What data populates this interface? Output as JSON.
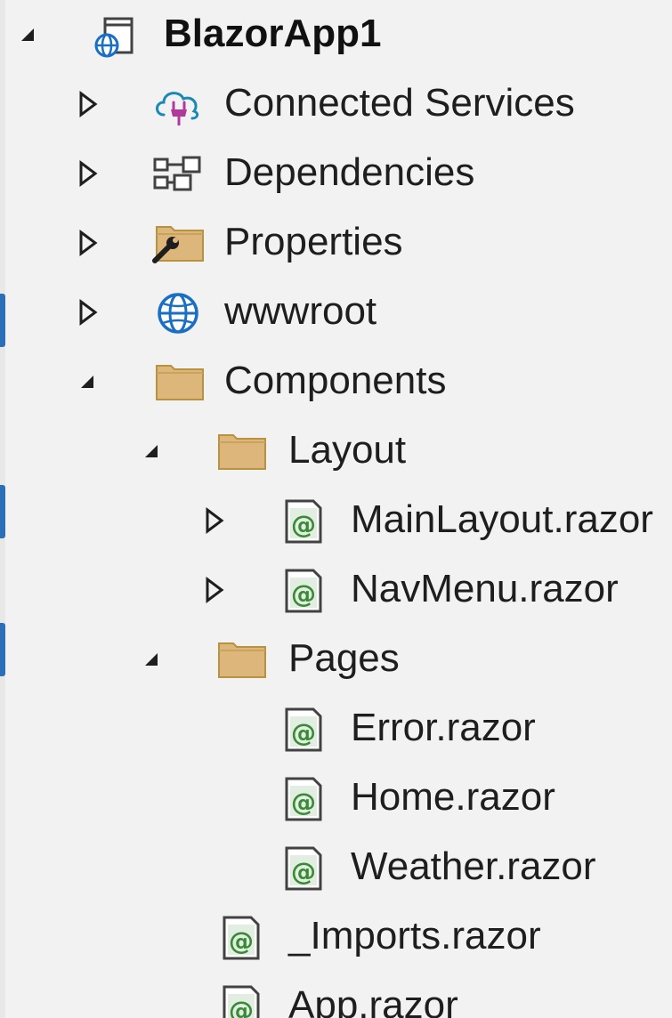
{
  "solution_explorer": {
    "project": {
      "label": "BlazorApp1",
      "icon": "web-project-icon",
      "expanded": true
    },
    "items": [
      {
        "label": "Connected Services",
        "icon": "connected-services-icon",
        "expanded": false,
        "depth": 1
      },
      {
        "label": "Dependencies",
        "icon": "dependencies-icon",
        "expanded": false,
        "depth": 1
      },
      {
        "label": "Properties",
        "icon": "properties-folder-icon",
        "expanded": false,
        "depth": 1
      },
      {
        "label": "wwwroot",
        "icon": "globe-icon",
        "expanded": false,
        "depth": 1
      },
      {
        "label": "Components",
        "icon": "folder-icon",
        "expanded": true,
        "depth": 1
      },
      {
        "label": "Layout",
        "icon": "folder-icon",
        "expanded": true,
        "depth": 2
      },
      {
        "label": "MainLayout.razor",
        "icon": "razor-file-icon",
        "expanded": false,
        "depth": 3
      },
      {
        "label": "NavMenu.razor",
        "icon": "razor-file-icon",
        "expanded": false,
        "depth": 3
      },
      {
        "label": "Pages",
        "icon": "folder-icon",
        "expanded": true,
        "depth": 2
      },
      {
        "label": "Error.razor",
        "icon": "razor-file-icon",
        "depth": 3
      },
      {
        "label": "Home.razor",
        "icon": "razor-file-icon",
        "depth": 3
      },
      {
        "label": "Weather.razor",
        "icon": "razor-file-icon",
        "depth": 3
      },
      {
        "label": "_Imports.razor",
        "icon": "razor-file-icon",
        "depth": 2
      },
      {
        "label": "App.razor",
        "icon": "razor-file-icon",
        "depth": 2
      }
    ]
  },
  "colors": {
    "background": "#f2f2f2",
    "folder": "#dcb67a",
    "razor_green": "#388a34",
    "globe_blue": "#1a6fc4",
    "connected_teal": "#1a8ab4"
  }
}
